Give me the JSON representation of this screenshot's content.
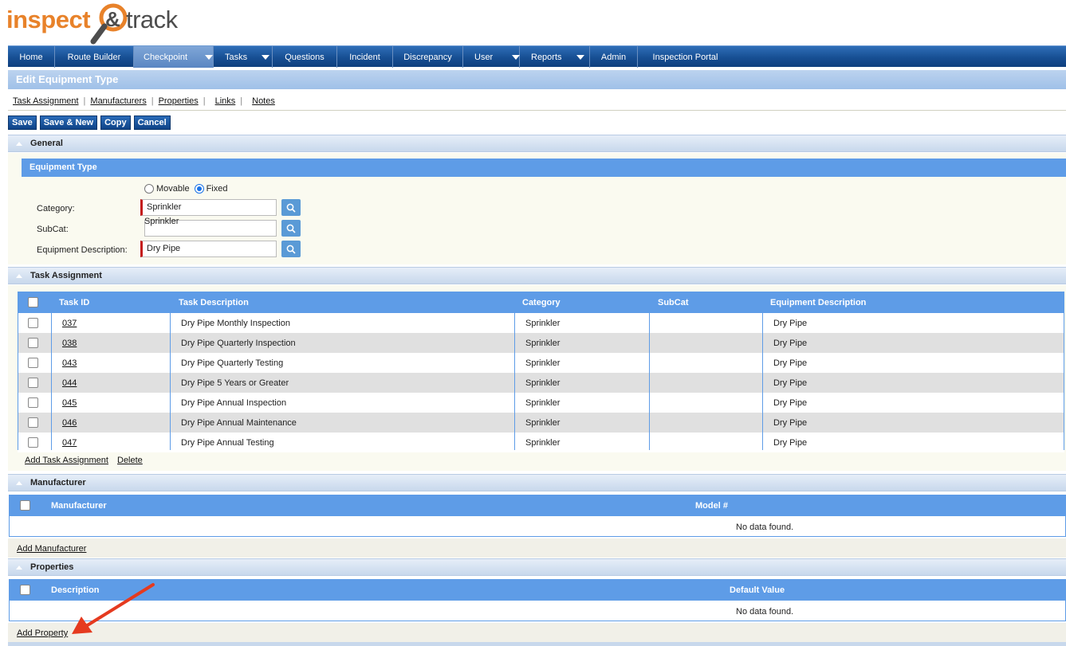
{
  "logo": {
    "word1": "inspect",
    "amp": "&",
    "word2": "track"
  },
  "nav": {
    "home": "Home",
    "route_builder": "Route Builder",
    "checkpoint": "Checkpoint",
    "tasks": "Tasks",
    "questions": "Questions",
    "incident": "Incident",
    "discrepancy": "Discrepancy",
    "user": "User",
    "reports": "Reports",
    "admin": "Admin",
    "inspection_portal": "Inspection Portal"
  },
  "page": {
    "title": "Edit Equipment Type",
    "subnav": [
      "Task Assignment",
      "Manufacturers",
      "Properties",
      "Links",
      "Notes"
    ]
  },
  "buttons": {
    "save": "Save",
    "save_new": "Save & New",
    "copy": "Copy",
    "cancel": "Cancel"
  },
  "general": {
    "section_title": "General",
    "panel_title": "Equipment Type",
    "radio_movable": "Movable",
    "radio_fixed": "Fixed",
    "selected_radio": "Fixed",
    "category_label": "Category:",
    "category_value": "Sprinkler",
    "subcat_label": "SubCat:",
    "subcat_value": "",
    "subcat_suggestion": "Sprinkler",
    "equip_desc_label": "Equipment Description:",
    "equip_desc_value": "Dry Pipe"
  },
  "task_assignment": {
    "section_title": "Task Assignment",
    "columns": [
      "Task ID",
      "Task Description",
      "Category",
      "SubCat",
      "Equipment Description"
    ],
    "rows": [
      {
        "id": "037",
        "desc": "Dry Pipe Monthly Inspection",
        "category": "Sprinkler",
        "subcat": "",
        "equip": "Dry Pipe"
      },
      {
        "id": "038",
        "desc": "Dry Pipe Quarterly Inspection",
        "category": "Sprinkler",
        "subcat": "",
        "equip": "Dry Pipe"
      },
      {
        "id": "043",
        "desc": "Dry Pipe Quarterly Testing",
        "category": "Sprinkler",
        "subcat": "",
        "equip": "Dry Pipe"
      },
      {
        "id": "044",
        "desc": "Dry Pipe 5 Years or Greater",
        "category": "Sprinkler",
        "subcat": "",
        "equip": "Dry Pipe"
      },
      {
        "id": "045",
        "desc": "Dry Pipe Annual Inspection",
        "category": "Sprinkler",
        "subcat": "",
        "equip": "Dry Pipe"
      },
      {
        "id": "046",
        "desc": "Dry Pipe Annual Maintenance",
        "category": "Sprinkler",
        "subcat": "",
        "equip": "Dry Pipe"
      },
      {
        "id": "047",
        "desc": "Dry Pipe Annual Testing",
        "category": "Sprinkler",
        "subcat": "",
        "equip": "Dry Pipe"
      }
    ],
    "add_link": "Add Task Assignment",
    "delete_link": "Delete"
  },
  "manufacturer": {
    "section_title": "Manufacturer",
    "columns": [
      "Manufacturer",
      "Model #"
    ],
    "empty_text": "No data found.",
    "add_link": "Add Manufacturer"
  },
  "properties": {
    "section_title": "Properties",
    "columns": [
      "Description",
      "Default Value"
    ],
    "empty_text": "No data found.",
    "add_link": "Add Property"
  },
  "colors": {
    "nav_blue": "#174f93",
    "grid_header_blue": "#5e9ce7",
    "logo_orange": "#e8822a",
    "required_marker": "#c41a1a",
    "annotation_arrow": "#e53a1f"
  }
}
